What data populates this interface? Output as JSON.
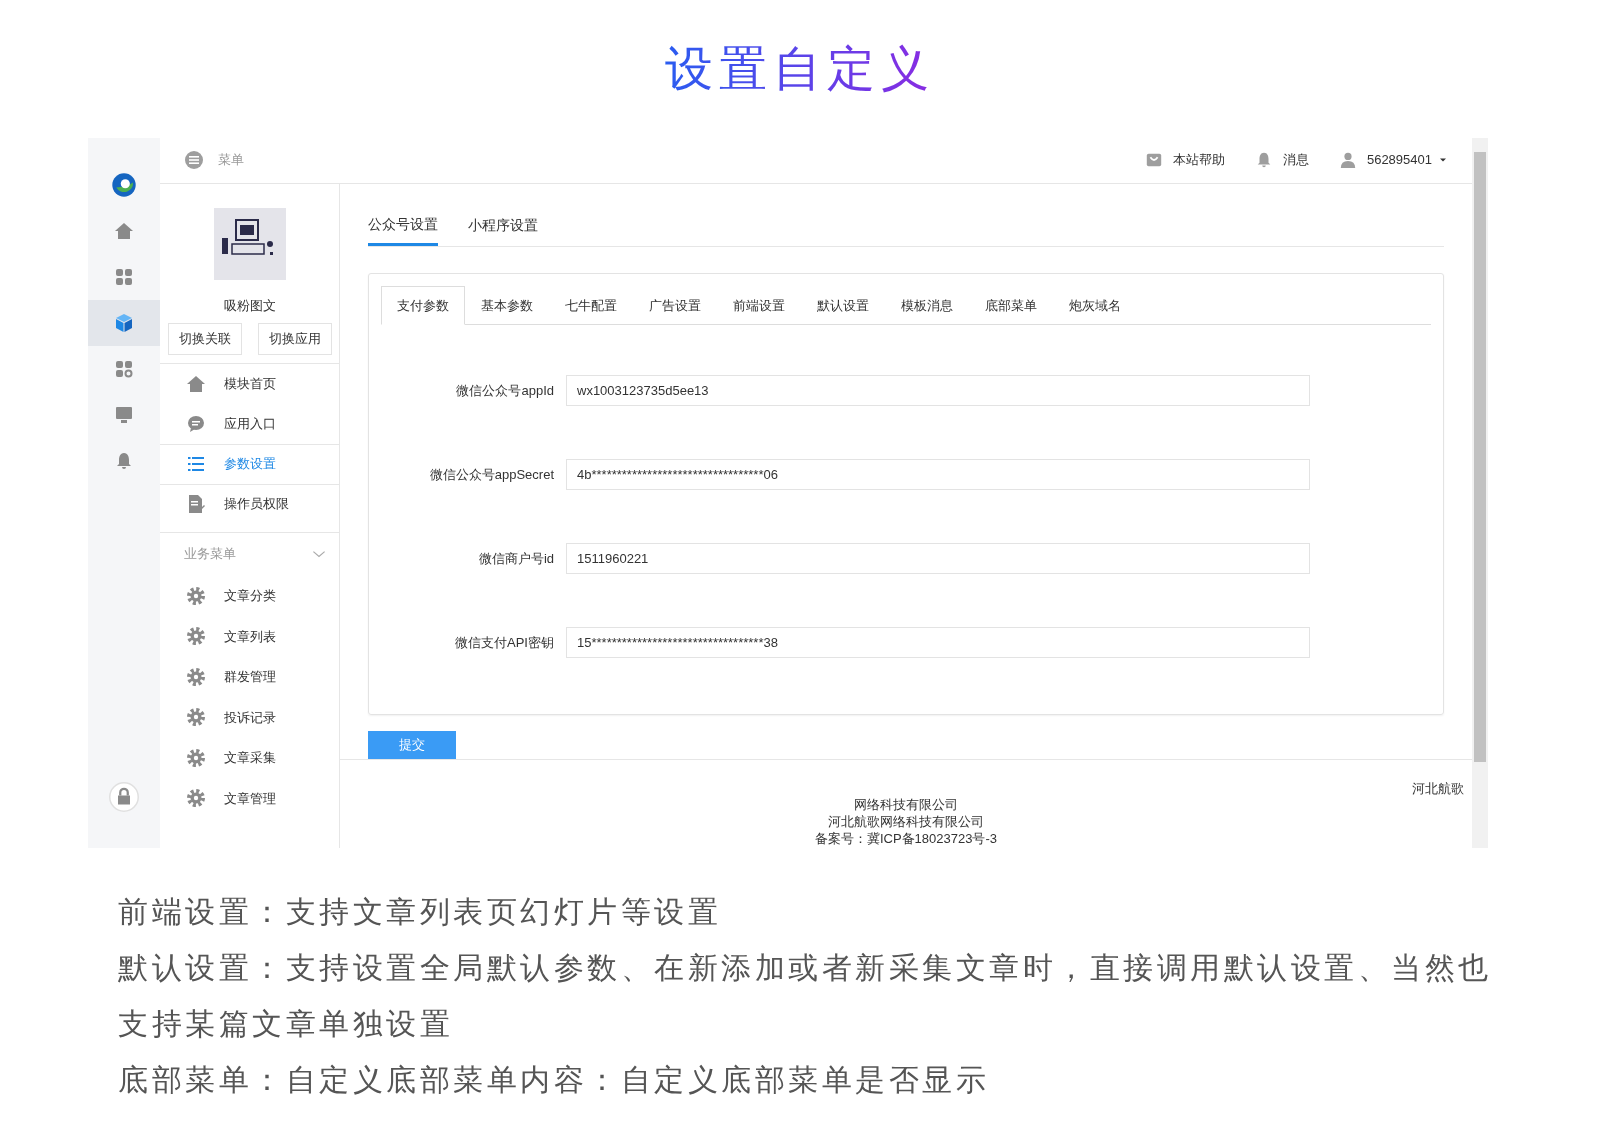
{
  "title": "设置自定义",
  "app": {
    "rail": [
      {
        "kind": "home",
        "selected": false
      },
      {
        "kind": "grid",
        "selected": false
      },
      {
        "kind": "cube",
        "selected": true
      },
      {
        "kind": "grid-gear",
        "selected": false
      },
      {
        "kind": "monitor",
        "selected": false
      },
      {
        "kind": "bell",
        "selected": false
      },
      {
        "kind": "lock",
        "selected": false
      }
    ],
    "topbar": {
      "menu": "菜单",
      "help": "本站帮助",
      "messages": "消息",
      "user": "562895401"
    },
    "module": {
      "name": "吸粉图文",
      "buttons": [
        "切换关联",
        "切换应用"
      ]
    },
    "nav": [
      {
        "label": "模块首页",
        "kind": "home",
        "selected": false
      },
      {
        "label": "应用入口",
        "kind": "chat",
        "selected": false
      },
      {
        "label": "参数设置",
        "kind": "list",
        "selected": true
      },
      {
        "label": "操作员权限",
        "kind": "doc",
        "selected": false
      }
    ],
    "section": {
      "title": "业务菜单",
      "expanded": true,
      "items": [
        {
          "label": "文章分类"
        },
        {
          "label": "文章列表"
        },
        {
          "label": "群发管理"
        },
        {
          "label": "投诉记录"
        },
        {
          "label": "文章采集"
        },
        {
          "label": "文章管理"
        }
      ]
    },
    "tabs": [
      {
        "label": "公众号设置",
        "selected": true
      },
      {
        "label": "小程序设置",
        "selected": false
      }
    ],
    "subtabs": [
      {
        "label": "支付参数",
        "selected": true
      },
      {
        "label": "基本参数",
        "selected": false
      },
      {
        "label": "七牛配置",
        "selected": false
      },
      {
        "label": "广告设置",
        "selected": false
      },
      {
        "label": "前端设置",
        "selected": false
      },
      {
        "label": "默认设置",
        "selected": false
      },
      {
        "label": "模板消息",
        "selected": false
      },
      {
        "label": "底部菜单",
        "selected": false
      },
      {
        "label": "炮灰域名",
        "selected": false
      }
    ],
    "fields": [
      {
        "label": "微信公众号appId",
        "value": "wx1003123735d5ee13"
      },
      {
        "label": "微信公众号appSecret",
        "value": "4b**********************************06"
      },
      {
        "label": "微信商户号id",
        "value": "1511960221"
      },
      {
        "label": "微信支付API密钥",
        "value": "15**********************************38"
      }
    ],
    "submit": "提交",
    "footer": {
      "corner": "河北航歌",
      "lines": [
        "网络科技有限公司",
        "河北航歌网络科技有限公司",
        "备案号：冀ICP备18023723号-3"
      ]
    }
  },
  "paragraphs": [
    "前端设置：支持文章列表页幻灯片等设置",
    "默认设置：支持设置全局默认参数、在新添加或者新采集文章时，直接调用默认设置、当然也支持某篇文章单独设置",
    "底部菜单：自定义底部菜单内容：自定义底部菜单是否显示"
  ]
}
